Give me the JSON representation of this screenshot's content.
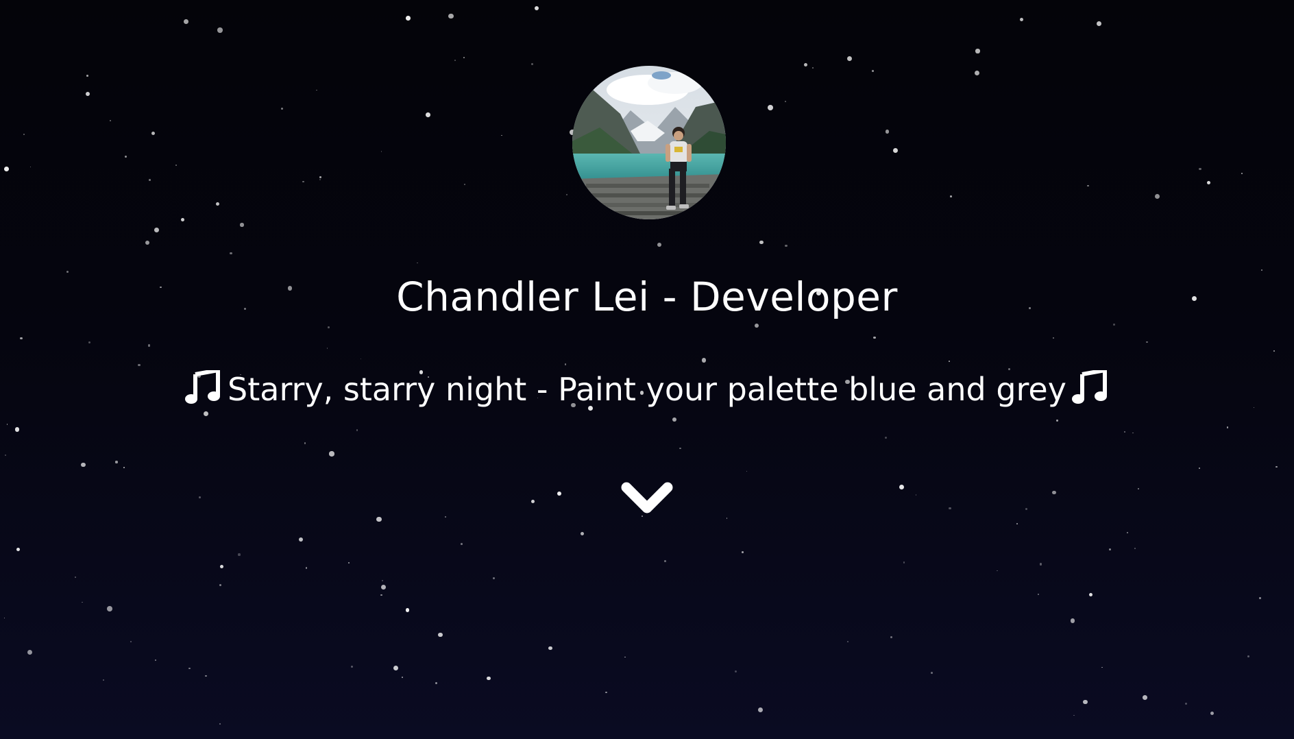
{
  "profile": {
    "avatar_alt": "profile photo at a mountain lake",
    "title": "Chandler Lei - Developer",
    "tagline": "Starry, starry night - Paint your palette blue and grey"
  },
  "icons": {
    "tagline_left": "music-note-icon",
    "tagline_right": "music-note-icon",
    "scroll": "chevron-down-icon"
  },
  "colors": {
    "background_top": "#040409",
    "background_bottom": "#0a0b22",
    "text": "#ffffff",
    "star": "#ffffff"
  }
}
